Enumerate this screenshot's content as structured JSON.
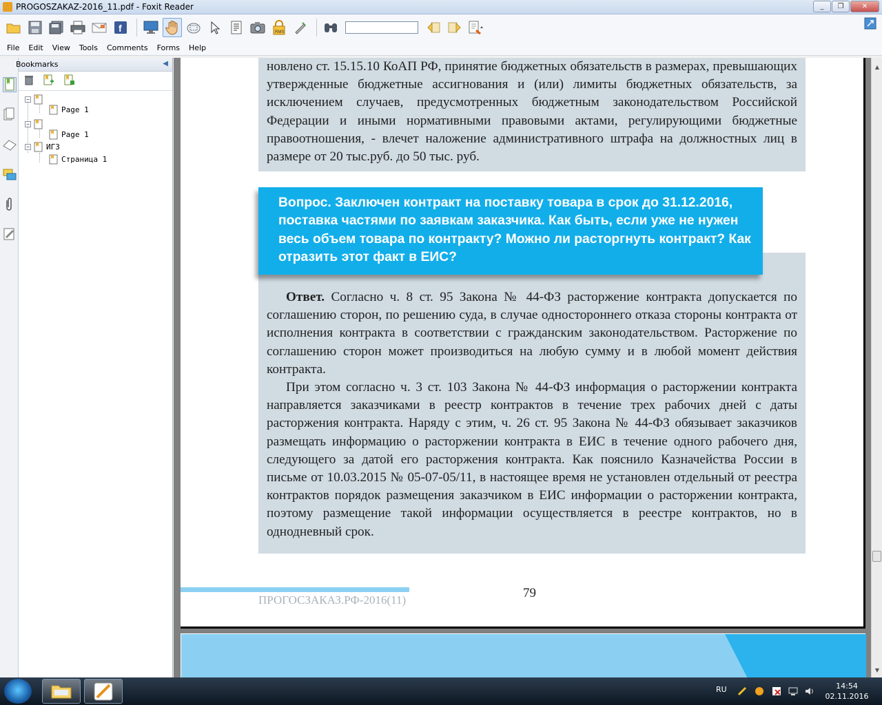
{
  "window": {
    "title": "PROGOSZAKAZ-2016_11.pdf - Foxit Reader"
  },
  "toolbar": {
    "find_value": ""
  },
  "menu": [
    "File",
    "Edit",
    "View",
    "Tools",
    "Comments",
    "Forms",
    "Help"
  ],
  "bookmarks": {
    "title": "Bookmarks",
    "items": [
      {
        "label": "Page 1"
      },
      {
        "label": "Page 1"
      },
      {
        "label": "ИГЗ"
      },
      {
        "label": "Страница 1"
      }
    ]
  },
  "document": {
    "para1": "новлено ст. 15.15.10 КоАП РФ, принятие бюджетных обязательств в размерах, превышающих утвержденные бюджетные ассигнования и (или) лимиты бюджетных обязательств, за исключением случаев, предусмотренных бюджетным законодательством Российской Федерации и иными нормативными правовыми актами, регулирующими бюджетные правоотношения, - влечет наложение административного штрафа на должностных лиц в размере от 20 тыс.руб. до 50 тыс. руб.",
    "question": "Вопрос. Заключен контракт на поставку товара в срок до 31.12.2016, поставка частями по заявкам заказчика. Как быть, если уже не нужен весь объем товара по контракту? Можно ли расторгнуть контракт? Как отразить этот факт в ЕИС?",
    "answer_label": "Ответ.",
    "answer_p1": " Согласно ч. 8 ст. 95 Закона № 44-ФЗ расторжение контракта допускается по соглашению сторон, по решению суда, в случае одностороннего отказа стороны контракта от исполнения контракта в соответствии с гражданским законодательством. Расторжение по соглашению сторон может производиться на любую сумму и в любой момент действия контракта.",
    "answer_p2": "При этом согласно ч. 3 ст. 103 Закона № 44-ФЗ информация о расторжении контракта направляется заказчиками в реестр контрактов в течение трех рабочих дней с даты расторжения контракта. Наряду с этим, ч. 26 ст. 95 Закона № 44-ФЗ обязывает заказчиков размещать информацию о расторжении контракта в ЕИС в течение одного рабочего дня, следующего за датой его расторжения контракта. Как пояснило Казначейства России в письме от 10.03.2015 № 05-07-05/11, в настоящее время не установлен отдельный от реестра контрактов порядок размещения заказчиком в ЕИС информации о расторжении контракта, поэтому размещение такой информации осуществляется в реестре контрактов, но в однодневный срок.",
    "footer": "ПРОГОСЗАКАЗ.РФ-2016(11)",
    "page_number": "79"
  },
  "taskbar": {
    "language": "RU",
    "time": "14:54",
    "date": "02.11.2016"
  },
  "colors": {
    "question_bg": "#12aeea",
    "box_bg": "#d0dbe2",
    "accent_band": "#8bd0f3"
  }
}
